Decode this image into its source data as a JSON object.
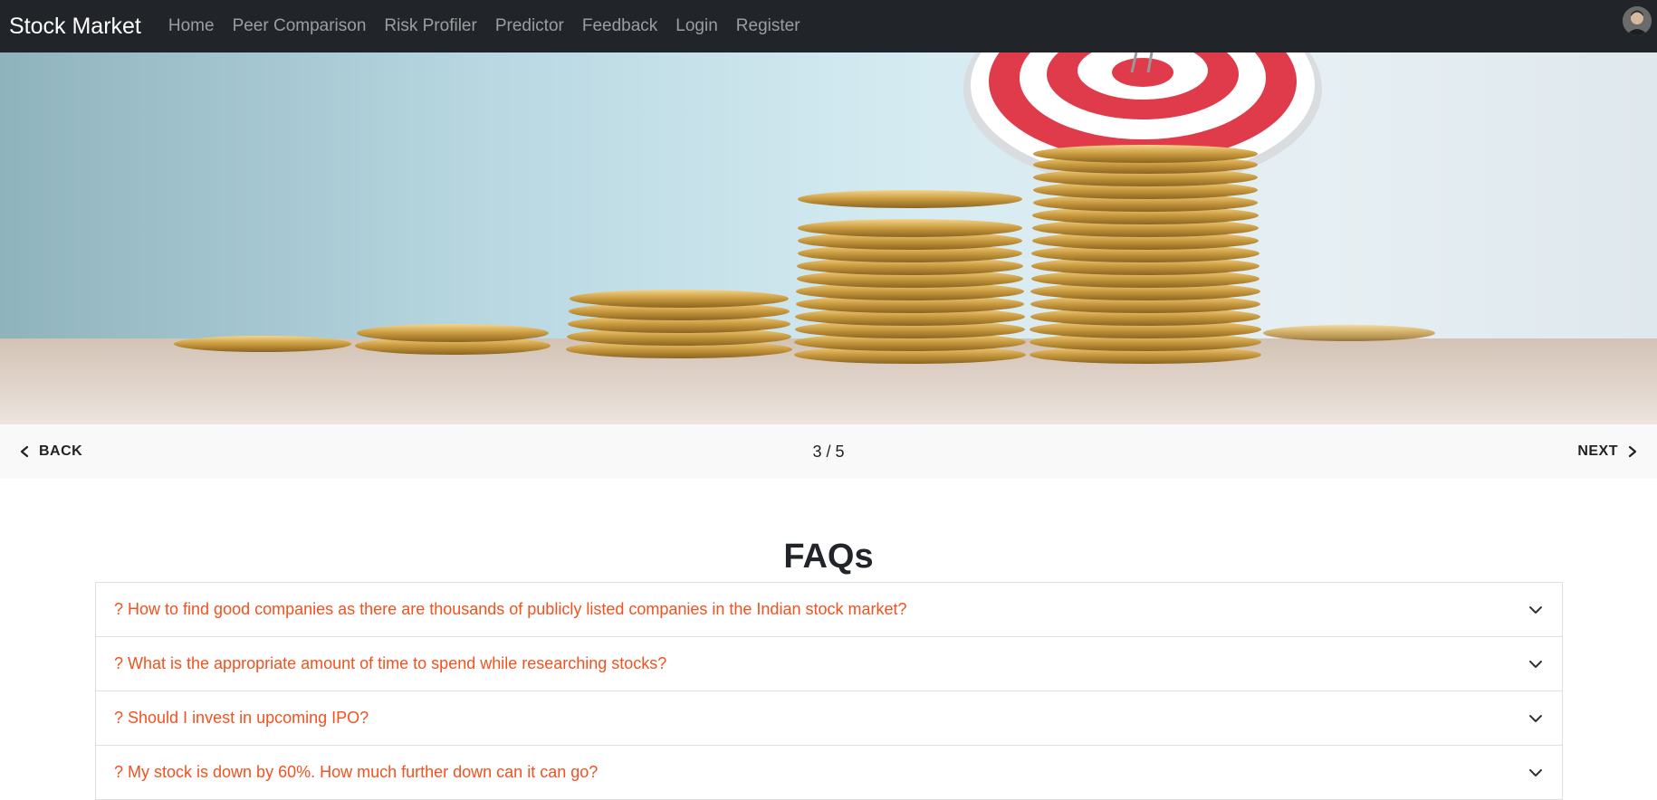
{
  "navbar": {
    "brand": "Stock Market",
    "links": [
      "Home",
      "Peer Comparison",
      "Risk Profiler",
      "Predictor",
      "Feedback",
      "Login",
      "Register"
    ]
  },
  "carousel": {
    "back_label": "BACK",
    "next_label": "NEXT",
    "page": "3 / 5"
  },
  "faq": {
    "title": "FAQs",
    "items": [
      "? How to find good companies as there are thousands of publicly listed companies in the Indian stock market?",
      "? What is the appropriate amount of time to spend while researching stocks?",
      "? Should I invest in upcoming IPO?",
      "? My stock is down by 60%. How much further down can it can go?"
    ]
  },
  "colors": {
    "navbar_bg": "#212529",
    "accent_orange": "#f4511e",
    "controls_bg": "#f9f9f9"
  },
  "icons": {
    "back": "chevron-left-icon",
    "next": "chevron-right-icon",
    "expand": "chevron-down-icon"
  }
}
